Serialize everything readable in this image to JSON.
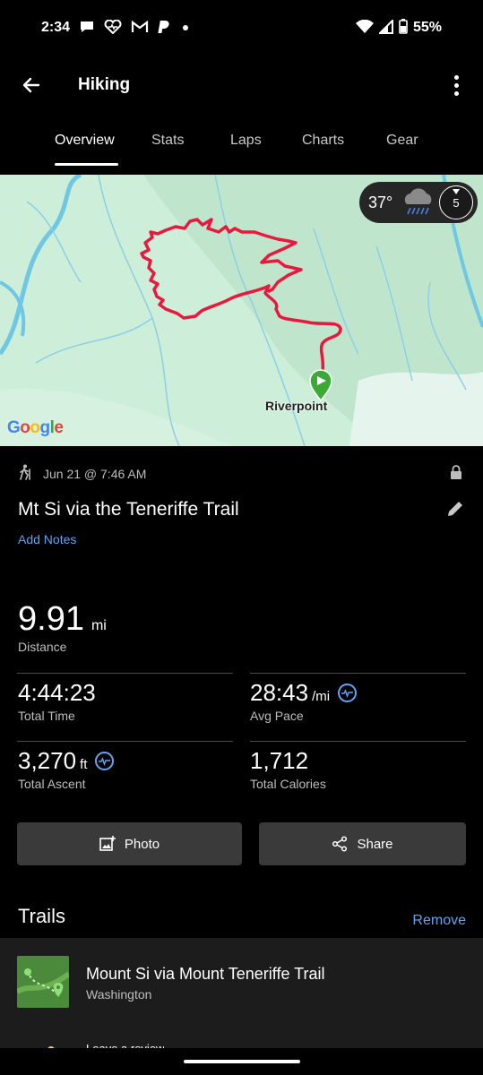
{
  "status_bar": {
    "time": "2:34",
    "battery": "55%",
    "notification_icons": [
      "chat-bubble-icon",
      "heart-rate-icon",
      "gmail-icon",
      "pandora-icon",
      "dot-icon"
    ],
    "system_icons": [
      "wifi-icon",
      "cell-signal-icon",
      "battery-icon"
    ]
  },
  "app_bar": {
    "title": "Hiking"
  },
  "tabs": [
    {
      "label": "Overview",
      "active": true
    },
    {
      "label": "Stats",
      "active": false
    },
    {
      "label": "Laps",
      "active": false
    },
    {
      "label": "Charts",
      "active": false
    },
    {
      "label": "Gear",
      "active": false
    }
  ],
  "map": {
    "weather_temp": "37°",
    "wind_speed": "5",
    "location_label": "Riverpoint",
    "provider": "Google",
    "route_color": "#e8193c",
    "start_marker_color": "#3aaa35"
  },
  "activity": {
    "date": "Jun 21 @ 7:46 AM",
    "title": "Mt Si via the Teneriffe Trail",
    "add_notes": "Add Notes"
  },
  "stats": {
    "distance": {
      "value": "9.91",
      "unit": "mi",
      "label": "Distance"
    },
    "total_time": {
      "value": "4:44:23",
      "unit": "",
      "label": "Total Time"
    },
    "avg_pace": {
      "value": "28:43",
      "unit": "/mi",
      "label": "Avg Pace"
    },
    "total_ascent": {
      "value": "3,270",
      "unit": "ft",
      "label": "Total Ascent"
    },
    "total_calories": {
      "value": "1,712",
      "unit": "",
      "label": "Total Calories"
    }
  },
  "actions": {
    "photo": "Photo",
    "share": "Share"
  },
  "trails": {
    "heading": "Trails",
    "remove": "Remove",
    "trail_name": "Mount Si via Mount Teneriffe Trail",
    "trail_region": "Washington",
    "review": "Leave a review"
  },
  "colors": {
    "accent": "#5fa5f2",
    "button_bg": "#3a3a3a",
    "card_bg": "#1c1c1c"
  }
}
